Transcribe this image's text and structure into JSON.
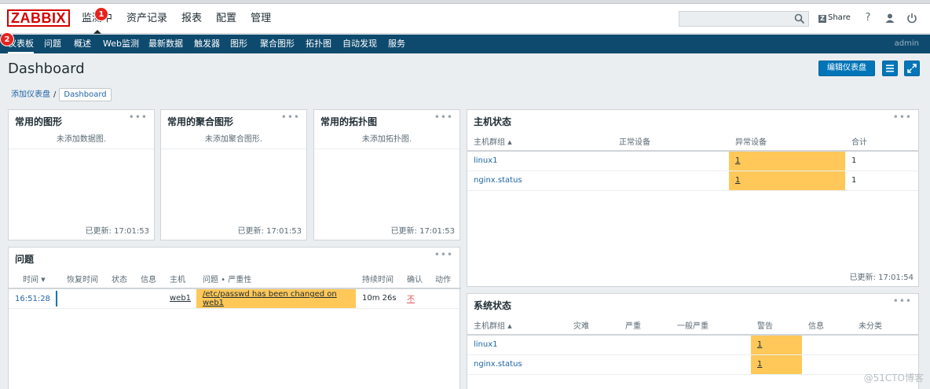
{
  "header": {
    "logo": "ZABBIX",
    "top_menu": [
      "监测中",
      "资产记录",
      "报表",
      "配置",
      "管理"
    ],
    "share_label": "Share",
    "share_icon": "zabbix-share-icon",
    "help": "?",
    "badge1": "1",
    "badge2": "2"
  },
  "subnav": {
    "items": [
      "仪表板",
      "问题",
      "概述",
      "Web监测",
      "最新数据",
      "触发器",
      "图形",
      "聚合图形",
      "拓扑图",
      "自动发现",
      "服务"
    ],
    "user": "admin"
  },
  "page": {
    "title": "Dashboard",
    "edit_button": "编辑仪表盘",
    "breadcrumb_parent": "添加仪表盘",
    "breadcrumb_current": "Dashboard"
  },
  "widgets": {
    "fav_graphs": {
      "title": "常用的图形",
      "empty": "未添加数据图.",
      "updated": "已更新: 17:01:53"
    },
    "fav_screens": {
      "title": "常用的聚合图形",
      "empty": "未添加聚合图形.",
      "updated": "已更新: 17:01:53"
    },
    "fav_maps": {
      "title": "常用的拓扑图",
      "empty": "未添加拓扑图.",
      "updated": "已更新: 17:01:53"
    },
    "problems": {
      "title": "问题",
      "columns": [
        "时间",
        "恢复时间",
        "状态",
        "信息",
        "主机",
        "问题 • 严重性",
        "持续时间",
        "确认",
        "动作"
      ],
      "rows": [
        {
          "time": "16:51:28",
          "recovery": "",
          "status": "",
          "info": "",
          "host": "web1",
          "problem": "/etc/passwd has been changed on web1",
          "duration": "10m 26s",
          "ack": "不",
          "actions": ""
        }
      ]
    },
    "host_status": {
      "title": "主机状态",
      "columns": [
        "主机群组",
        "正常设备",
        "异常设备",
        "合计"
      ],
      "rows": [
        {
          "group": "linux1",
          "ok": "",
          "problem": "1",
          "total": "1"
        },
        {
          "group": "nginx.status",
          "ok": "",
          "problem": "1",
          "total": "1"
        }
      ],
      "updated": "已更新: 17:01:54"
    },
    "system_status": {
      "title": "系统状态",
      "columns": [
        "主机群组",
        "灾难",
        "严重",
        "一般严重",
        "警告",
        "信息",
        "未分类"
      ],
      "rows": [
        {
          "group": "linux1",
          "disaster": "",
          "high": "",
          "average": "",
          "warning": "1",
          "info": "",
          "nc": ""
        },
        {
          "group": "nginx.status",
          "disaster": "",
          "high": "",
          "average": "",
          "warning": "1",
          "info": "",
          "nc": ""
        }
      ]
    }
  },
  "watermark": "@51CTO博客"
}
